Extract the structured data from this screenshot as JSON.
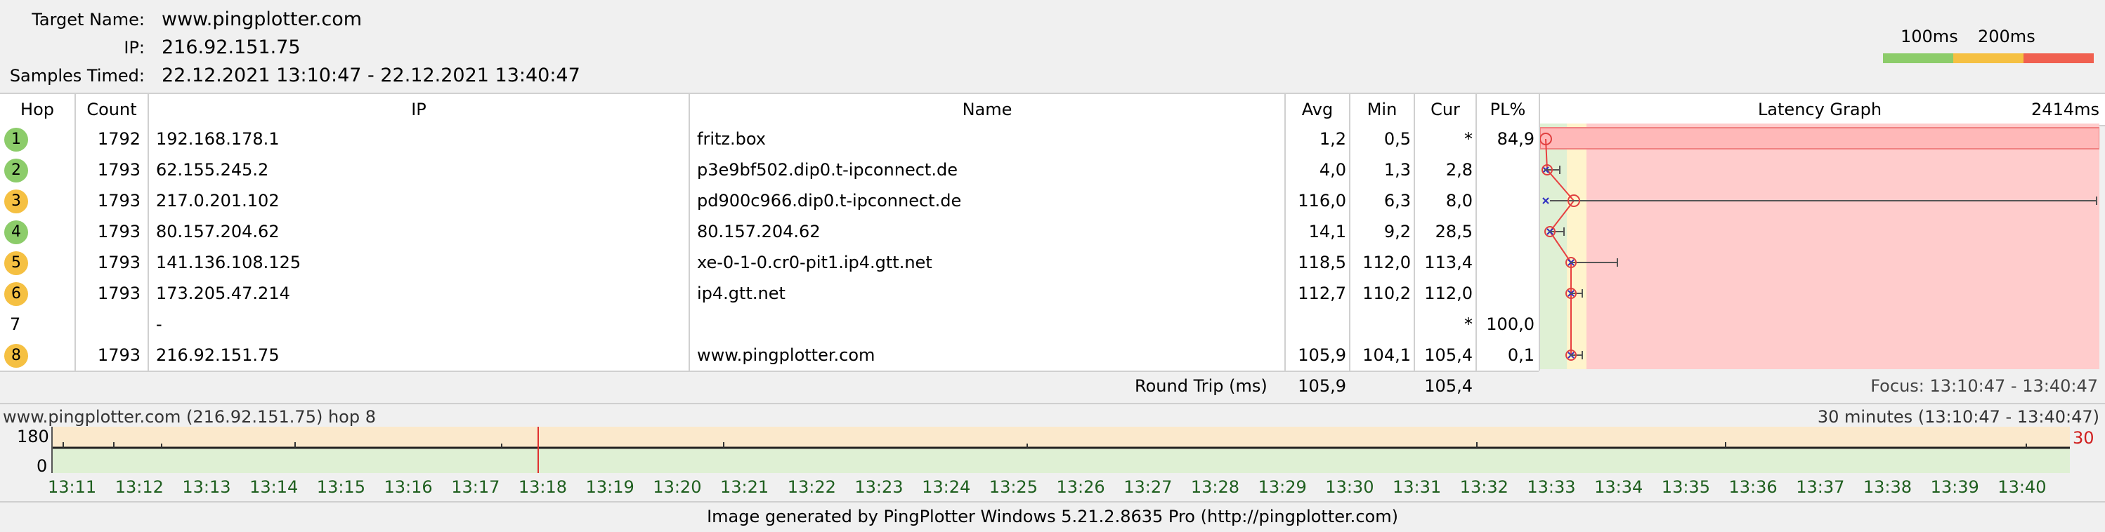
{
  "header": {
    "target_label": "Target Name:",
    "target_value": "www.pingplotter.com",
    "ip_label": "IP:",
    "ip_value": "216.92.151.75",
    "samples_label": "Samples Timed:",
    "samples_value": "22.12.2021 13:10:47 - 22.12.2021 13:40:47"
  },
  "legend": {
    "label_100": "100ms",
    "label_200": "200ms",
    "colors": {
      "good": "#8ccc6a",
      "warn": "#f5c042",
      "bad": "#f06050"
    }
  },
  "table": {
    "headers": {
      "hop": "Hop",
      "count": "Count",
      "ip": "IP",
      "name": "Name",
      "avg": "Avg",
      "min": "Min",
      "cur": "Cur",
      "pl": "PL%",
      "graph": "Latency Graph",
      "graph_max": "2414ms"
    },
    "rows": [
      {
        "hop": "1",
        "count": "1792",
        "ip": "192.168.178.1",
        "name": "fritz.box",
        "avg": "1,2",
        "min": "0,5",
        "cur": "*",
        "pl": "84,9",
        "dot": "green"
      },
      {
        "hop": "2",
        "count": "1793",
        "ip": "62.155.245.2",
        "name": "p3e9bf502.dip0.t-ipconnect.de",
        "avg": "4,0",
        "min": "1,3",
        "cur": "2,8",
        "pl": "",
        "dot": "green"
      },
      {
        "hop": "3",
        "count": "1793",
        "ip": "217.0.201.102",
        "name": "pd900c966.dip0.t-ipconnect.de",
        "avg": "116,0",
        "min": "6,3",
        "cur": "8,0",
        "pl": "",
        "dot": "yellow"
      },
      {
        "hop": "4",
        "count": "1793",
        "ip": "80.157.204.62",
        "name": "80.157.204.62",
        "avg": "14,1",
        "min": "9,2",
        "cur": "28,5",
        "pl": "",
        "dot": "green"
      },
      {
        "hop": "5",
        "count": "1793",
        "ip": "141.136.108.125",
        "name": "xe-0-1-0.cr0-pit1.ip4.gtt.net",
        "avg": "118,5",
        "min": "112,0",
        "cur": "113,4",
        "pl": "",
        "dot": "yellow"
      },
      {
        "hop": "6",
        "count": "1793",
        "ip": "173.205.47.214",
        "name": "ip4.gtt.net",
        "avg": "112,7",
        "min": "110,2",
        "cur": "112,0",
        "pl": "",
        "dot": "yellow"
      },
      {
        "hop": "7",
        "count": "",
        "ip": "-",
        "name": "",
        "avg": "",
        "min": "",
        "cur": "*",
        "pl": "100,0",
        "dot": "none"
      },
      {
        "hop": "8",
        "count": "1793",
        "ip": "216.92.151.75",
        "name": "www.pingplotter.com",
        "avg": "105,9",
        "min": "104,1",
        "cur": "105,4",
        "pl": "0,1",
        "dot": "yellow"
      }
    ],
    "round_trip_label": "Round Trip (ms)",
    "round_trip_avg": "105,9",
    "round_trip_cur": "105,4",
    "focus": "Focus: 13:10:47 - 13:40:47"
  },
  "timeline": {
    "title": "www.pingplotter.com (216.92.151.75) hop 8",
    "range": "30 minutes (13:10:47 - 13:40:47)",
    "y_max": "180",
    "y_min": "0",
    "right_value": "30",
    "ticks": [
      "13:11",
      "13:12",
      "13:13",
      "13:14",
      "13:15",
      "13:16",
      "13:17",
      "13:18",
      "13:19",
      "13:20",
      "13:21",
      "13:22",
      "13:23",
      "13:24",
      "13:25",
      "13:26",
      "13:27",
      "13:28",
      "13:29",
      "13:30",
      "13:31",
      "13:32",
      "13:33",
      "13:34",
      "13:35",
      "13:36",
      "13:37",
      "13:38",
      "13:39",
      "13:40"
    ]
  },
  "footer": "Image generated by PingPlotter Windows 5.21.2.8635 Pro (http://pingplotter.com)"
}
